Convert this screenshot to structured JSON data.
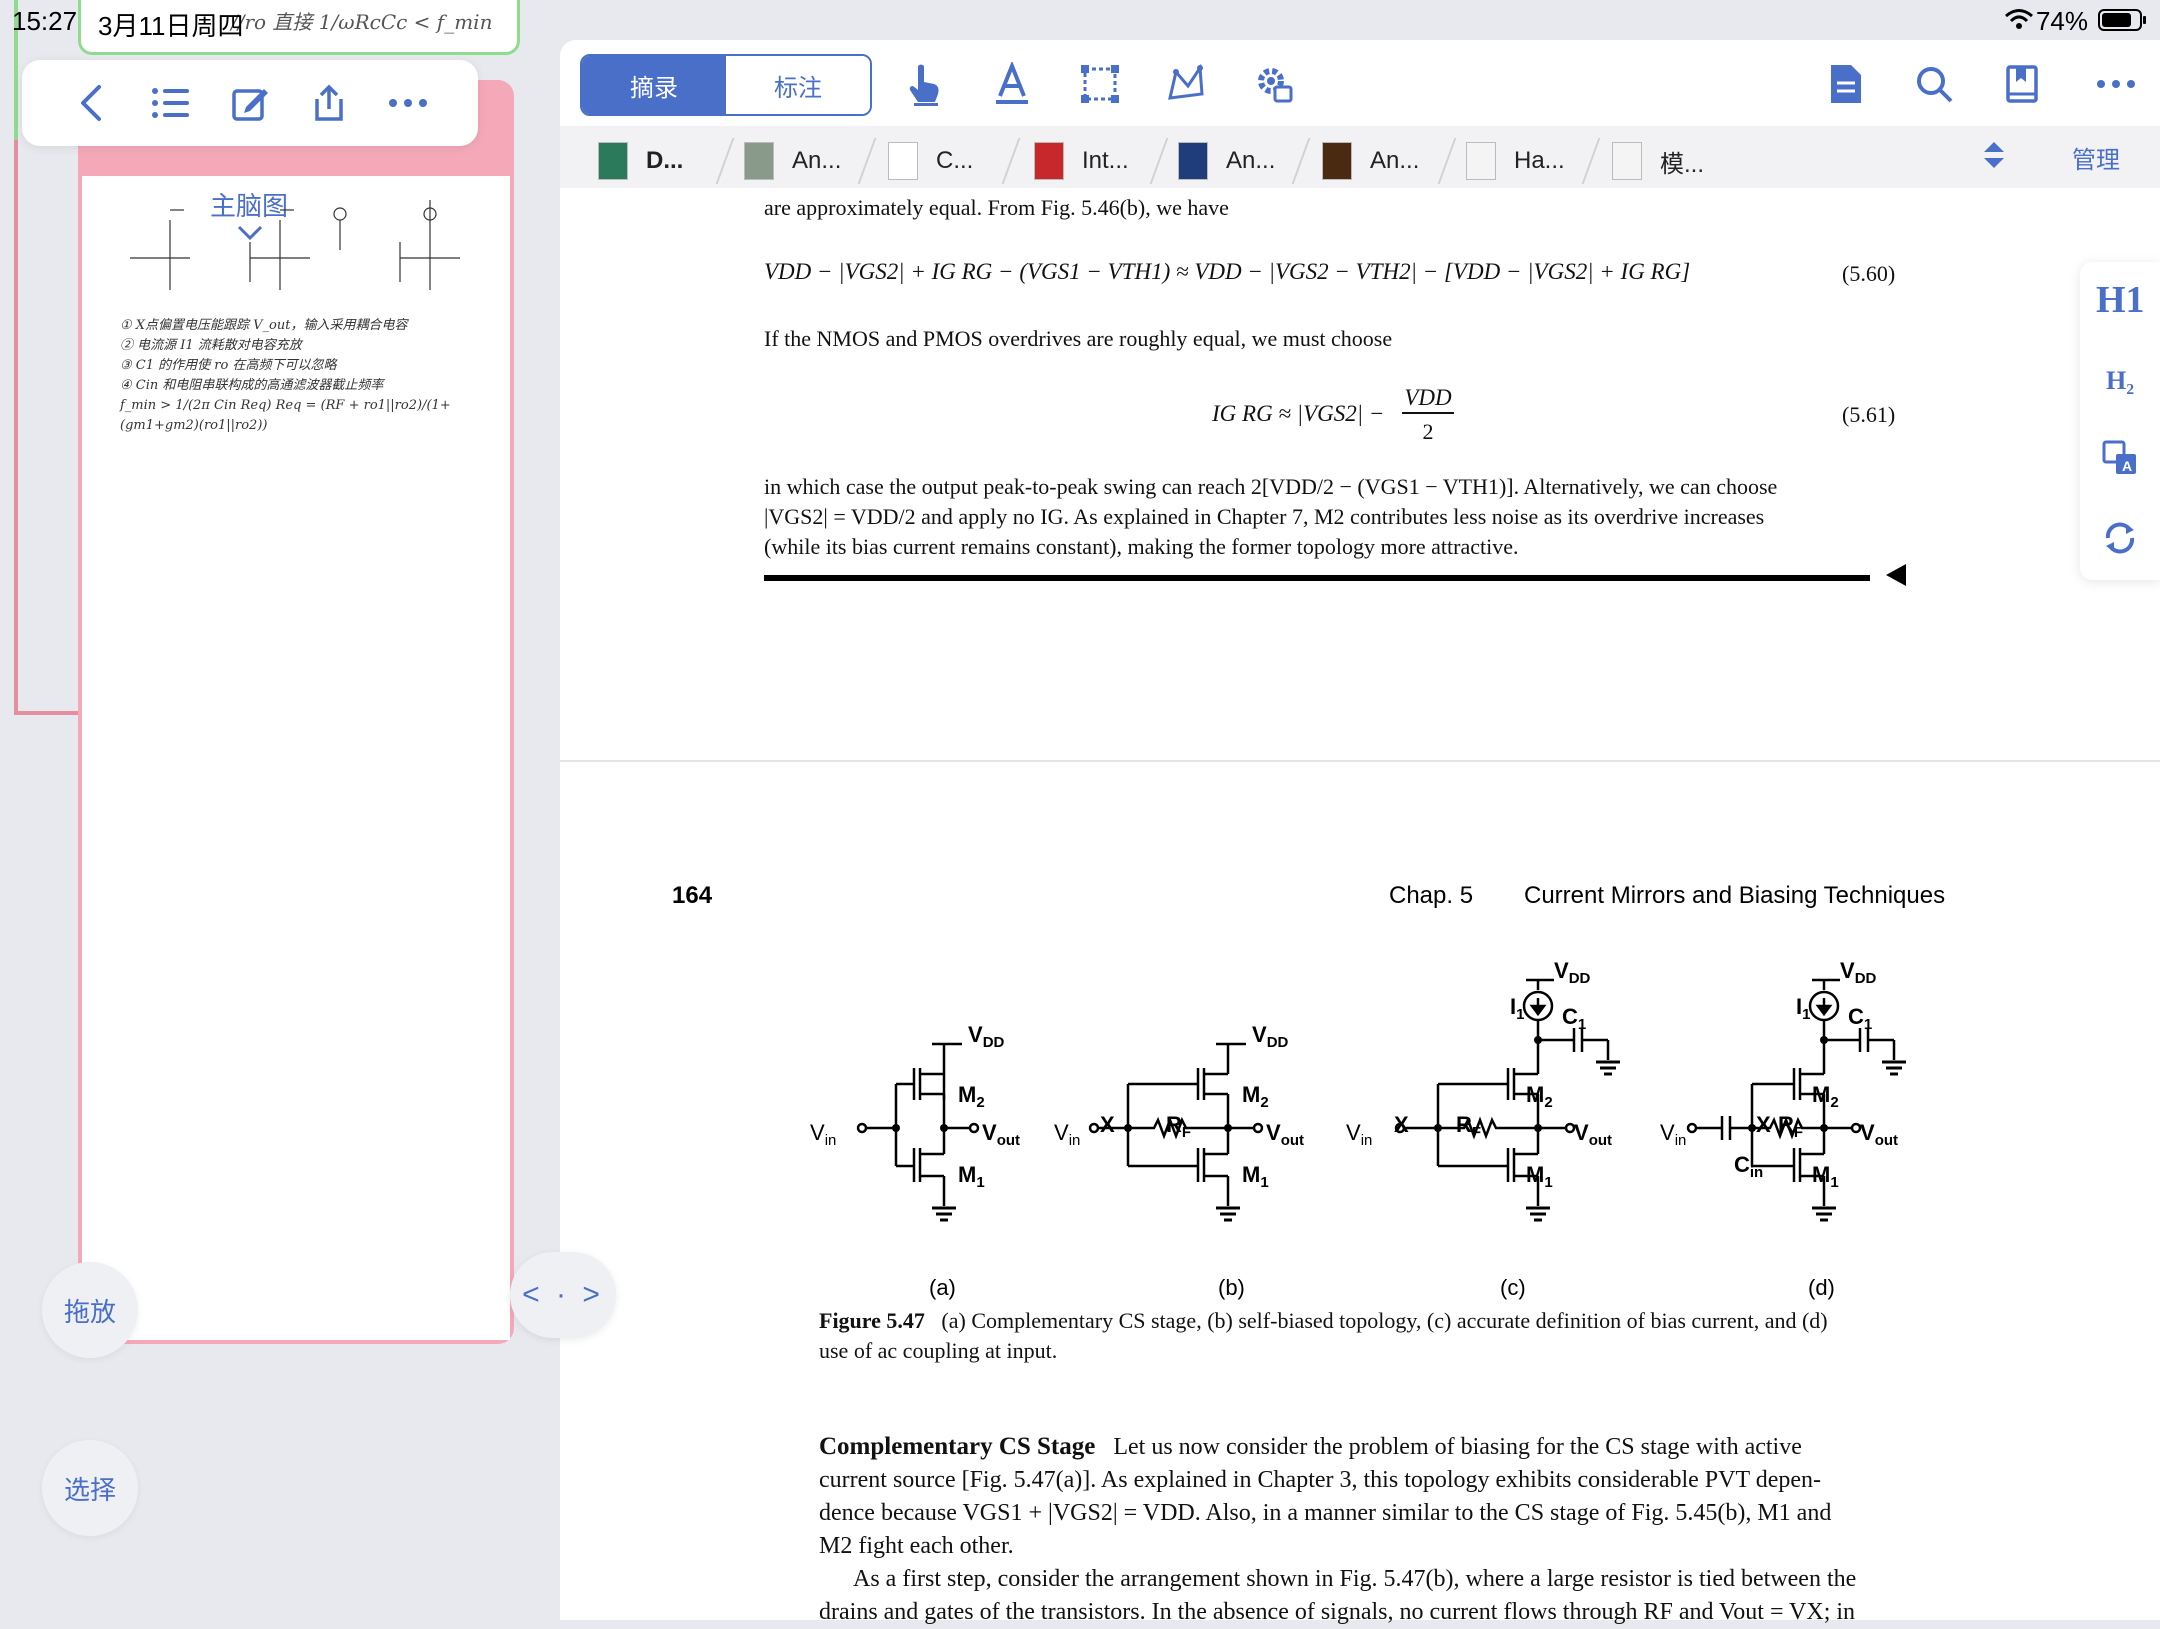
{
  "status": {
    "time": "15:27",
    "date": "3月11日周四",
    "battery": "74%"
  },
  "sticky": {
    "text": "//ro 直接 1/ωRcCc < f_min"
  },
  "left_toolbar": {
    "icons": [
      "back-icon",
      "list-icon",
      "edit-icon",
      "share-icon",
      "more-icon"
    ]
  },
  "card": {
    "title": "主脑图",
    "notes": [
      "① X点偏置电压能跟踪 V_out，输入采用耦合电容",
      "② 电流源 I1 流耗散对电容充放",
      "③ C1 的作用使 ro 在高频下可以忽略",
      "④ Cin 和电阻串联构成的高通滤波器截止频率",
      "f_min > 1/(2π Cin Req)    Req = (RF + ro1||ro2)/(1+(gm1+gm2)(ro1||ro2))"
    ]
  },
  "buttons": {
    "drag": "拖放",
    "select": "选择",
    "split": "< · >"
  },
  "reader_toolbar": {
    "excerpt": "摘录",
    "annotate": "标注",
    "manage": "管理"
  },
  "tabs": [
    {
      "label": "D...",
      "active": true
    },
    {
      "label": "An...",
      "active": false
    },
    {
      "label": "C...",
      "active": false
    },
    {
      "label": "Int...",
      "active": false
    },
    {
      "label": "An...",
      "active": false
    },
    {
      "label": "An...",
      "active": false
    },
    {
      "label": "Ha...",
      "active": false
    },
    {
      "label": "模...",
      "active": false
    }
  ],
  "side_panel": {
    "h1": "H1",
    "h2": "H₂"
  },
  "page_top": {
    "line1": "are approximately equal. From Fig. 5.46(b), we have",
    "eq560": "VDD − |VGS2| + IG RG − (VGS1 − VTH1) ≈ VDD − |VGS2 − VTH2| − [VDD − |VGS2| + IG RG]",
    "eq560_num": "(5.60)",
    "line2": "If the NMOS and PMOS overdrives are roughly equal, we must choose",
    "eq561_left": "IG RG ≈ |VGS2| −",
    "eq561_frac_num": "VDD",
    "eq561_frac_den": "2",
    "eq561_num": "(5.61)",
    "para": [
      "in which case the output peak-to-peak swing can reach 2[VDD/2 − (VGS1 − VTH1)]. Alternatively, we can choose",
      "|VGS2| = VDD/2 and apply no IG. As explained in Chapter 7, M2 contributes less noise as its overdrive increases",
      "(while its bias current remains constant), making the former topology more attractive."
    ]
  },
  "page_next": {
    "page_number": "164",
    "chapter": "Chap. 5",
    "chapter_title": "Current Mirrors and Biasing Techniques",
    "fig_labels": [
      "(a)",
      "(b)",
      "(c)",
      "(d)"
    ],
    "caption_bold": "Figure 5.47",
    "caption_line1": "(a) Complementary CS stage, (b) self-biased topology, (c) accurate definition of bias current, and (d)",
    "caption_line2": "use of ac coupling at input.",
    "section_title": "Complementary CS Stage",
    "body": [
      "Let us now consider the problem of biasing for the CS stage with active",
      "current source [Fig. 5.47(a)]. As explained in Chapter 3, this topology exhibits considerable PVT depen-",
      "dence because VGS1 + |VGS2| = VDD. Also, in a manner similar to the CS stage of Fig. 5.45(b), M1 and",
      "M2 fight each other.",
      "As a first step, consider the arrangement shown in Fig. 5.47(b), where a large resistor is tied between the",
      "drains and gates of the transistors. In the absence of signals, no current flows through RF and Vout = VX; in"
    ]
  },
  "circuit_labels": {
    "vdd": "VDD",
    "m1": "M1",
    "m2": "M2",
    "vin": "Vin",
    "vout": "Vout",
    "x": "X",
    "rf": "RF",
    "i1": "I1",
    "c1": "C1",
    "cin": "Cin"
  },
  "colors": {
    "accent": "#4a6fc8",
    "card": "#f5a9b8",
    "sticky": "#8fdc8f"
  }
}
